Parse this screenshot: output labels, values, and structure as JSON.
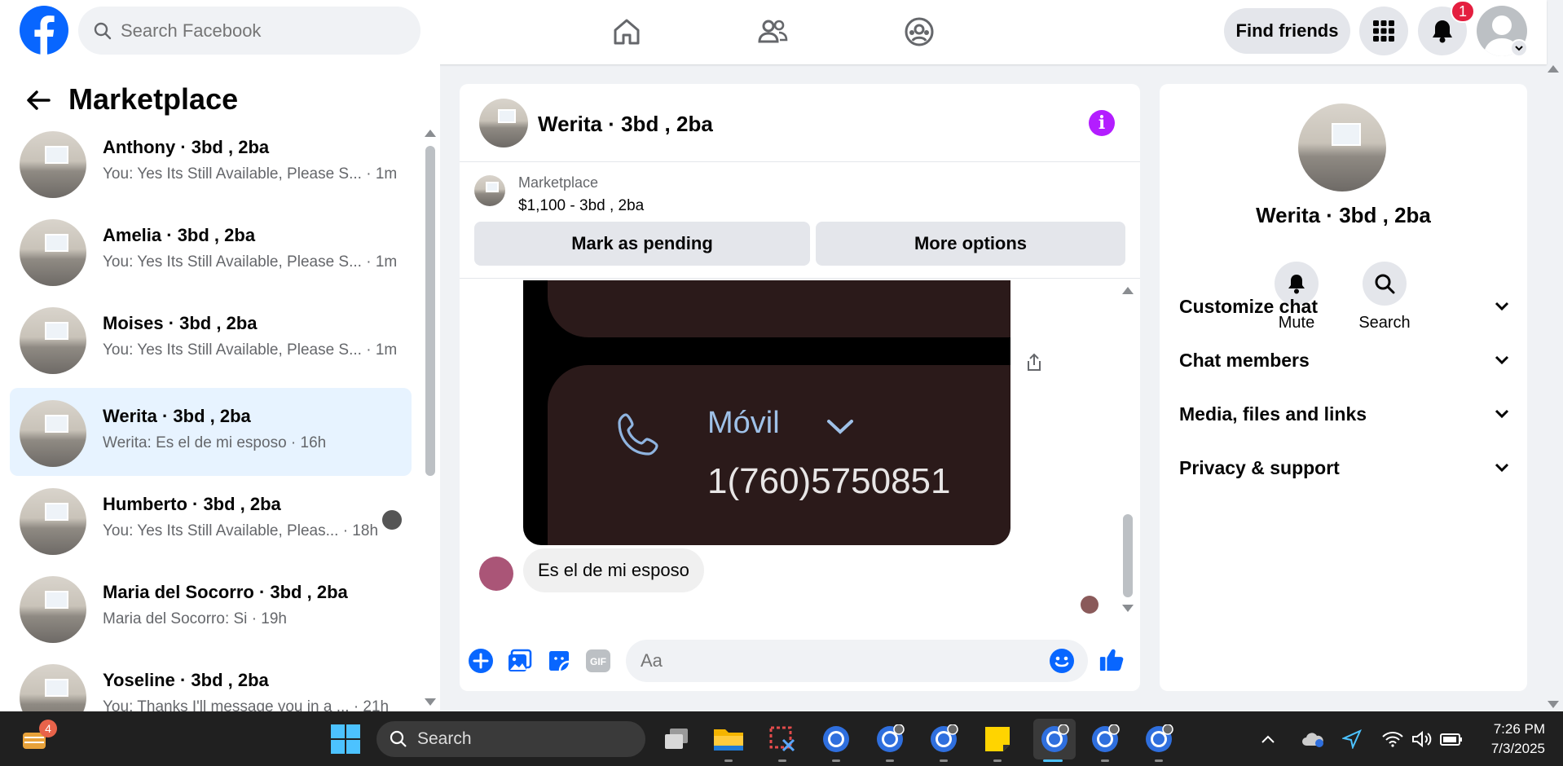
{
  "header": {
    "search_placeholder": "Search Facebook",
    "find_friends": "Find friends",
    "notification_count": "1",
    "nav_icons": [
      "home-icon",
      "friends-icon",
      "groups-icon"
    ]
  },
  "sidebar": {
    "title": "Marketplace",
    "conversations": [
      {
        "name": "Anthony · 3bd , 2ba",
        "preview": "You: Yes Its Still Available, Please S...",
        "time": "· 1m"
      },
      {
        "name": "Amelia · 3bd , 2ba",
        "preview": "You: Yes Its Still Available, Please S...",
        "time": "· 1m"
      },
      {
        "name": "Moises · 3bd , 2ba",
        "preview": "You: Yes Its Still Available, Please S...",
        "time": "· 1m"
      },
      {
        "name": "Werita · 3bd , 2ba",
        "preview": "Werita: Es el de mi esposo",
        "time": "· 16h"
      },
      {
        "name": "Humberto · 3bd , 2ba",
        "preview": "You: Yes Its Still Available, Pleas...",
        "time": "· 18h"
      },
      {
        "name": "Maria del Socorro · 3bd , 2ba",
        "preview": "Maria del Socorro: Si",
        "time": "· 19h"
      },
      {
        "name": "Yoseline · 3bd , 2ba",
        "preview": "You: Thanks I'll message you in a ...",
        "time": "· 21h"
      }
    ]
  },
  "chat": {
    "title": "Werita · 3bd , 2ba",
    "marketplace_label": "Marketplace",
    "listing": "$1,100 - 3bd , 2ba",
    "mark_pending": "Mark as pending",
    "more_options": "More options",
    "image_contact_type": "Móvil",
    "image_phone": "1(760)5750851",
    "message": "Es el de mi esposo",
    "composer_placeholder": "Aa"
  },
  "info_panel": {
    "name": "Werita · 3bd , 2ba",
    "mute": "Mute",
    "search": "Search",
    "sections": [
      "Customize chat",
      "Chat members",
      "Media, files and links",
      "Privacy & support"
    ]
  },
  "taskbar": {
    "search": "Search",
    "widgets_badge": "4",
    "time": "7:26 PM",
    "date": "7/3/2025"
  },
  "colors": {
    "facebook_blue": "#0866ff",
    "info_purple": "#b31dff",
    "active_row": "#e7f3ff",
    "badge_red": "#e41e3f"
  }
}
